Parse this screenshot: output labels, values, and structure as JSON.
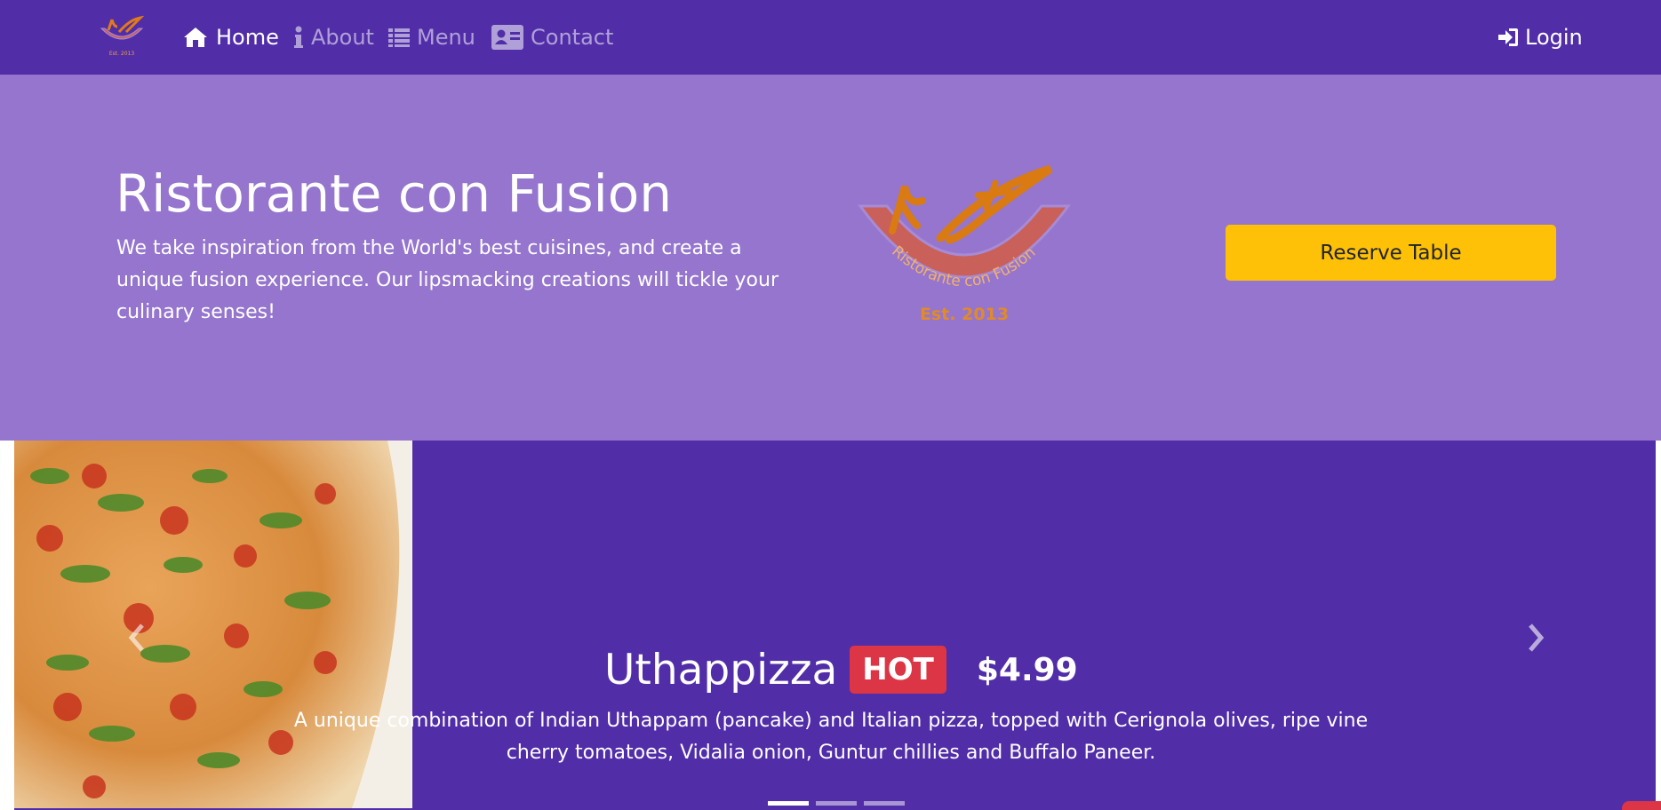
{
  "navbar": {
    "brand_logo_text": "Ristorante con Fusion Est. 2013",
    "items": [
      {
        "label": "Home",
        "icon": "home-icon",
        "active": true
      },
      {
        "label": "About",
        "icon": "info-icon",
        "active": false
      },
      {
        "label": "Menu",
        "icon": "list-icon",
        "active": false
      },
      {
        "label": "Contact",
        "icon": "address-card-icon",
        "active": false
      }
    ],
    "login": {
      "label": "Login",
      "icon": "sign-in-icon"
    }
  },
  "jumbotron": {
    "title": "Ristorante con Fusion",
    "text": "We take inspiration from the World's best cuisines, and create a unique fusion experience. Our lipsmacking creations will tickle your culinary senses!",
    "logo_text": "Ristorante con Fusion",
    "logo_est": "Est. 2013",
    "reserve_label": "Reserve Table"
  },
  "carousel": {
    "dish_name": "Uthappizza",
    "badge": "HOT",
    "price": "$4.99",
    "description": "A unique combination of Indian Uthappam (pancake) and Italian pizza, topped with Cerignola olives, ripe vine cherry tomatoes, Vidalia onion, Guntur chillies and Buffalo Paneer.",
    "indicators": [
      true,
      false,
      false
    ]
  },
  "colors": {
    "primary_dark": "#512DA8",
    "primary_light": "#9575CD",
    "warning": "#FFC107",
    "danger": "#dc3545"
  }
}
